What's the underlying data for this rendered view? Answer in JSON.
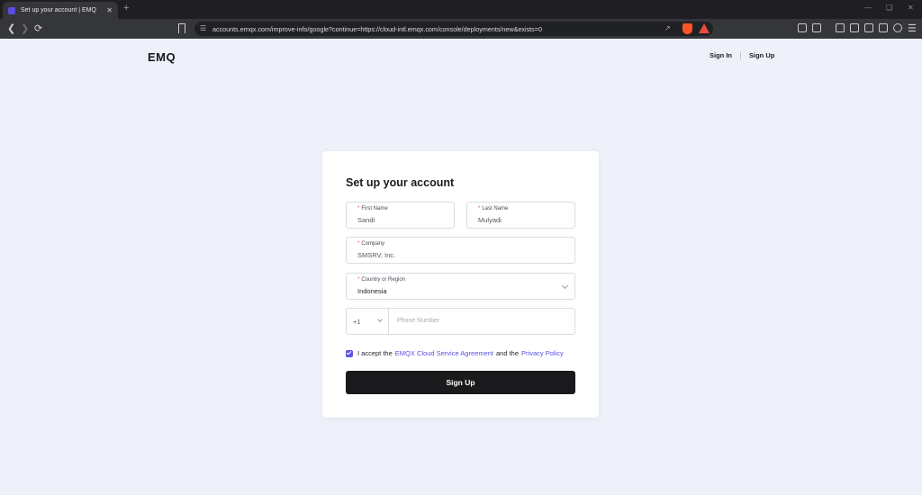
{
  "browser": {
    "tab_title": "Set up your account | EMQ",
    "tab_close": "✕",
    "new_tab": "+",
    "url": "accounts.emqx.com/improve-info/google?continue=https://cloud-intl.emqx.com/console/deployments/new&exists=0",
    "icons": [
      "back-icon",
      "forward-icon",
      "reload-icon",
      "bookmark-icon",
      "site-settings-icon",
      "share-icon",
      "brave-shield-icon",
      "brave-rewards-icon",
      "extensions-icon",
      "downloads-icon",
      "sidebar-icon",
      "wallet-icon",
      "leo-icon",
      "vpn-icon",
      "menu-icon"
    ]
  },
  "header": {
    "logo": "EMQ",
    "sign_in": "Sign In",
    "sign_up": "Sign Up"
  },
  "form": {
    "title": "Set up your account",
    "required_mark": "*",
    "first_name": {
      "label": "First Name",
      "value": "Sandi"
    },
    "last_name": {
      "label": "Last Name",
      "value": "Mulyadi"
    },
    "company": {
      "label": "Company",
      "value": "SMSRV, Inc."
    },
    "country": {
      "label": "Country or Region",
      "value": "Indonesia"
    },
    "phone": {
      "code": "+1",
      "placeholder": "Phone Number"
    },
    "agreement": {
      "checked": true,
      "prefix": "I accept the",
      "link1": "EMQX Cloud Service Agreement",
      "middle": "and the",
      "link2": "Privacy Policy"
    },
    "submit_label": "Sign Up"
  },
  "colors": {
    "accent": "#5a4fe0",
    "button": "#1a1a1d",
    "page_bg": "#eef0fa"
  }
}
